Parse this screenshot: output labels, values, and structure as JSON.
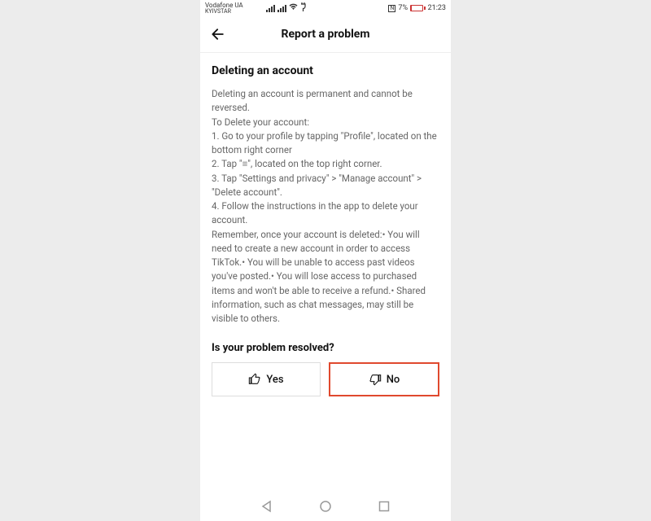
{
  "status": {
    "carrier1": "Vodafone UA",
    "carrier2": "KYIVSTAR",
    "nfc": "N",
    "battery_pct": "7%",
    "time": "21:23"
  },
  "header": {
    "title": "Report a problem"
  },
  "page": {
    "section_title": "Deleting an account",
    "body": "Deleting an account is permanent and cannot be reversed.\nTo Delete your account:\n1. Go to your profile by tapping \"Profile\", located on the bottom right corner\n2. Tap \"≡\", located on the top right corner.\n3. Tap \"Settings and privacy\" > \"Manage account\" > \"Delete account\".\n4. Follow the instructions in the app to delete your account.\nRemember, once your account is deleted:• You will need to create a new account in order to access TikTok.• You will be unable to access past videos you've posted.• You will lose access to purchased items and won't be able to receive a refund.• Shared information, such as chat messages, may still be visible to others.",
    "question": "Is your problem resolved?",
    "yes_label": "Yes",
    "no_label": "No"
  }
}
